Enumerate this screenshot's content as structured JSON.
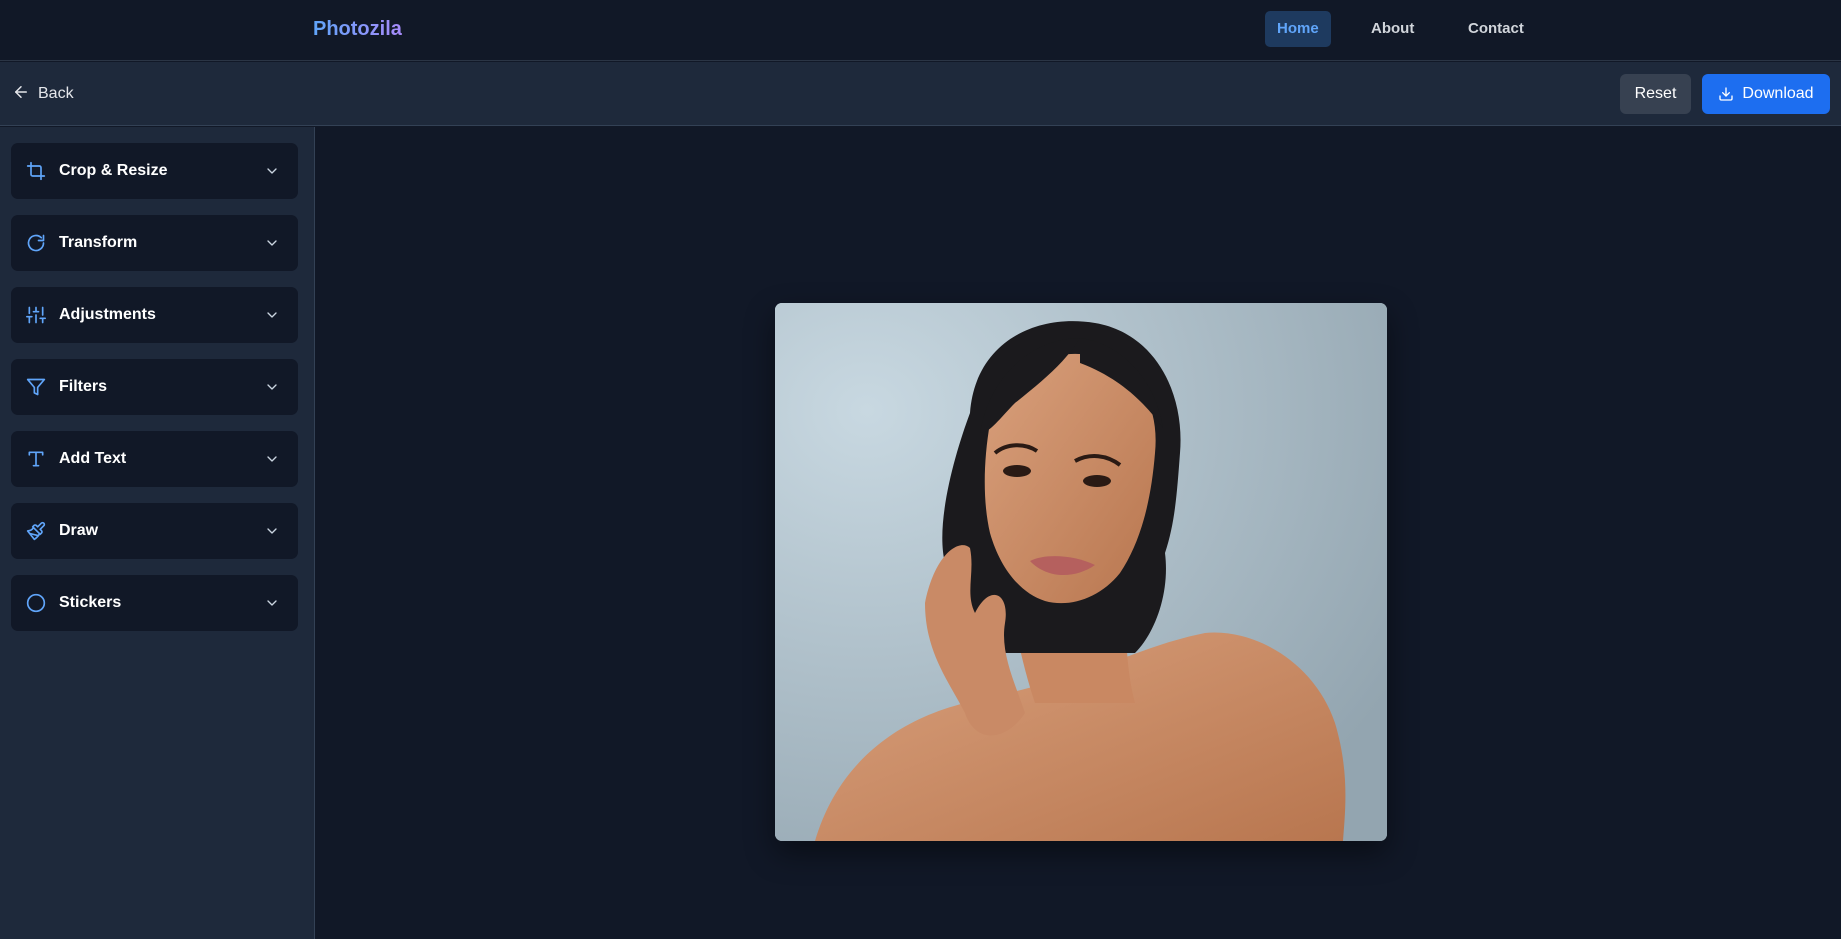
{
  "navbar": {
    "brand": "Photozila",
    "links": [
      {
        "label": "Home",
        "active": true
      },
      {
        "label": "About",
        "active": false
      },
      {
        "label": "Contact",
        "active": false
      }
    ]
  },
  "toolbar": {
    "back_label": "Back",
    "reset_label": "Reset",
    "download_label": "Download"
  },
  "sidebar": {
    "panels": [
      {
        "label": "Crop & Resize",
        "icon": "crop-icon"
      },
      {
        "label": "Transform",
        "icon": "rotate-icon"
      },
      {
        "label": "Adjustments",
        "icon": "sliders-icon"
      },
      {
        "label": "Filters",
        "icon": "filter-icon"
      },
      {
        "label": "Add Text",
        "icon": "text-icon"
      },
      {
        "label": "Draw",
        "icon": "brush-icon"
      },
      {
        "label": "Stickers",
        "icon": "circle-icon"
      }
    ]
  },
  "colors": {
    "background": "#111827",
    "panel": "#1e293b",
    "accent": "#1d6ef0",
    "icon_accent": "#60a5fa"
  }
}
